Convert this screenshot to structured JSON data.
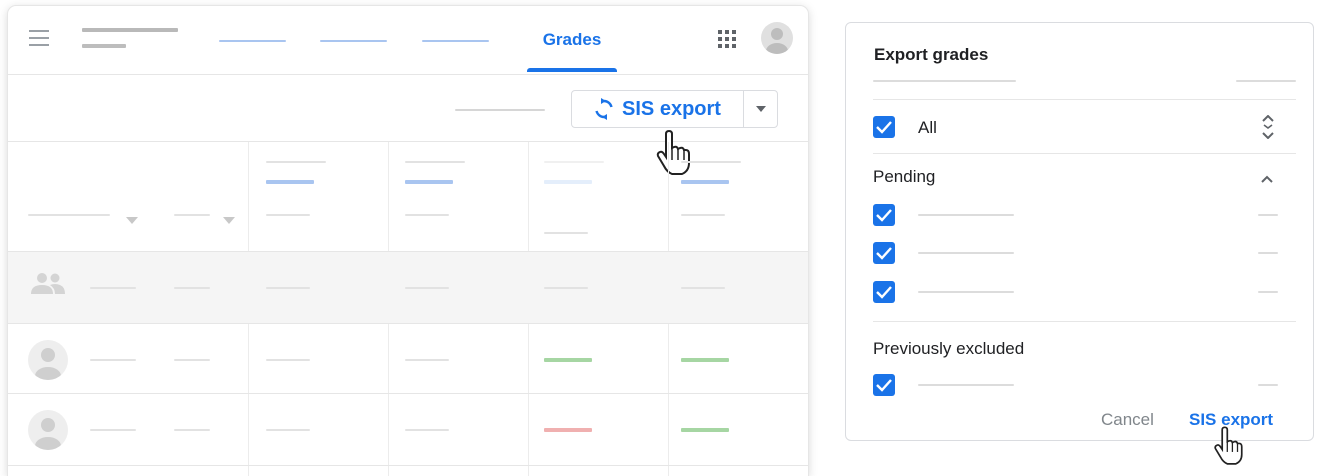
{
  "gradebook": {
    "active_tab": "Grades",
    "sis_export_label": "SIS export"
  },
  "dialog": {
    "title": "Export grades",
    "all_label": "All",
    "pending_label": "Pending",
    "previously_excluded_label": "Previously excluded",
    "cancel_label": "Cancel",
    "confirm_label": "SIS export",
    "checkboxes": {
      "all": true,
      "pending": [
        true,
        true,
        true
      ],
      "previously_excluded": [
        true
      ]
    }
  },
  "colors": {
    "accent": "#1a73e8",
    "placeholder_line": "#e2e2e2",
    "grade_good": "#a6d6a3",
    "grade_bad": "#f0b0b0"
  }
}
